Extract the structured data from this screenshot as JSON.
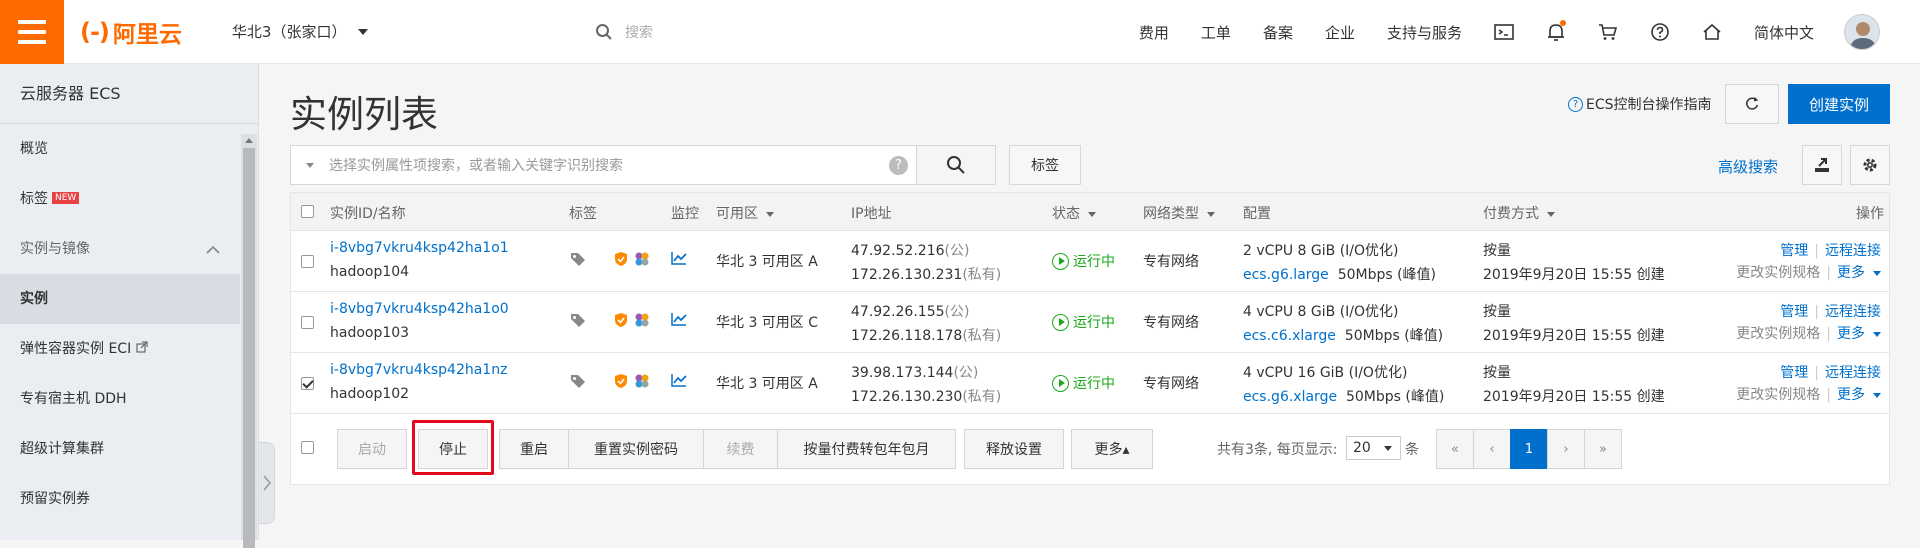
{
  "topbar": {
    "logo_mark": "(-)",
    "logo_text": "阿里云",
    "region": "华北3（张家口）",
    "search_placeholder": "搜索",
    "nav": [
      "费用",
      "工单",
      "备案",
      "企业",
      "支持与服务"
    ],
    "language": "简体中文"
  },
  "sidebar": {
    "title": "云服务器 ECS",
    "overview": "概览",
    "tags": "标签",
    "new_badge": "NEW",
    "group": "实例与镜像",
    "instances": "实例",
    "eci": "弹性容器实例 ECI",
    "ddh": "专有宿主机 DDH",
    "hpc": "超级计算集群",
    "reserved": "预留实例券"
  },
  "main": {
    "title": "实例列表",
    "guide": "ECS控制台操作指南",
    "create": "创建实例",
    "search_placeholder": "选择实例属性项搜索，或者输入关键字识别搜索",
    "tag_button": "标签",
    "advanced_search": "高级搜索"
  },
  "table": {
    "headers": {
      "id": "实例ID/名称",
      "tags": "标签",
      "monitor": "监控",
      "zone": "可用区",
      "ip": "IP地址",
      "status": "状态",
      "network": "网络类型",
      "config": "配置",
      "billing": "付费方式",
      "ops": "操作"
    },
    "rows": [
      {
        "id": "i-8vbg7vkru4ksp42ha1o1",
        "name": "hadoop104",
        "zone": "华北 3 可用区 A",
        "ip_public": "47.92.52.216",
        "ip_public_tag": "(公)",
        "ip_private": "172.26.130.231",
        "ip_private_tag": "(私有)",
        "status": "运行中",
        "network": "专有网络",
        "config1": "2 vCPU 8 GiB (I/O优化)",
        "spec": "ecs.g6.large",
        "bw": "50Mbps (峰值)",
        "billing": "按量",
        "created": "2019年9月20日 15:55 创建",
        "manage": "管理",
        "remote": "远程连接",
        "change_spec": "更改实例规格",
        "more": "更多",
        "checked": false
      },
      {
        "id": "i-8vbg7vkru4ksp42ha1o0",
        "name": "hadoop103",
        "zone": "华北 3 可用区 C",
        "ip_public": "47.92.26.155",
        "ip_public_tag": "(公)",
        "ip_private": "172.26.118.178",
        "ip_private_tag": "(私有)",
        "status": "运行中",
        "network": "专有网络",
        "config1": "4 vCPU 8 GiB (I/O优化)",
        "spec": "ecs.c6.xlarge",
        "bw": "50Mbps (峰值)",
        "billing": "按量",
        "created": "2019年9月20日 15:55 创建",
        "manage": "管理",
        "remote": "远程连接",
        "change_spec": "更改实例规格",
        "more": "更多",
        "checked": false
      },
      {
        "id": "i-8vbg7vkru4ksp42ha1nz",
        "name": "hadoop102",
        "zone": "华北 3 可用区 A",
        "ip_public": "39.98.173.144",
        "ip_public_tag": "(公)",
        "ip_private": "172.26.130.230",
        "ip_private_tag": "(私有)",
        "status": "运行中",
        "network": "专有网络",
        "config1": "4 vCPU 16 GiB (I/O优化)",
        "spec": "ecs.g6.xlarge",
        "bw": "50Mbps (峰值)",
        "billing": "按量",
        "created": "2019年9月20日 15:55 创建",
        "manage": "管理",
        "remote": "远程连接",
        "change_spec": "更改实例规格",
        "more": "更多",
        "checked": true
      }
    ]
  },
  "footer": {
    "start": "启动",
    "stop": "停止",
    "restart": "重启",
    "reset_password": "重置实例密码",
    "renew": "续费",
    "convert": "按量付费转包年包月",
    "release": "释放设置",
    "more": "更多▴",
    "total_text": "共有3条, 每页显示:",
    "page_size": "20",
    "unit": "条",
    "current_page": "1"
  },
  "colors": {
    "brand": "#ff6a00",
    "primary": "#0070cc",
    "running": "#1ba81b",
    "highlight": "#e4081b"
  }
}
